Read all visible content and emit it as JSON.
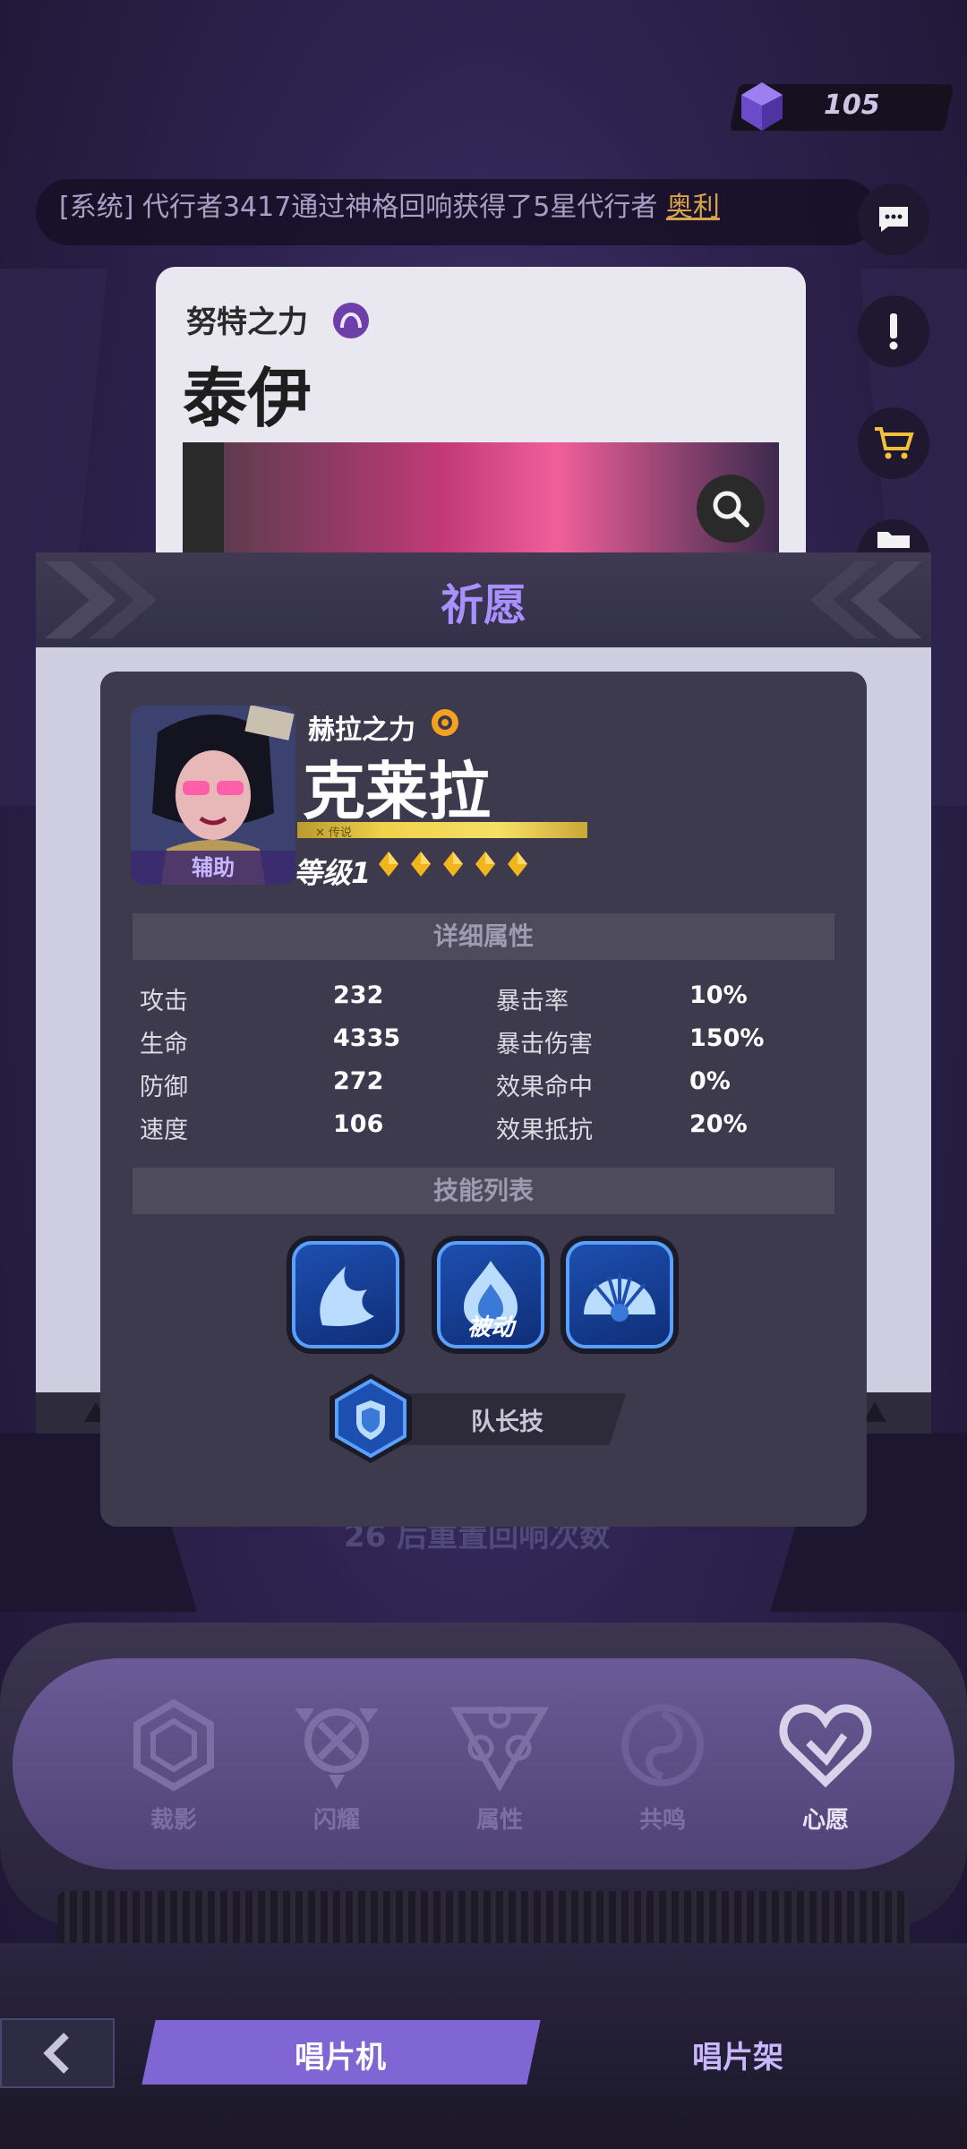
{
  "top_bar": {
    "currency_value": "105"
  },
  "ticker": {
    "prefix": "[系统] 代行者3417通过神格回响获得了5星代行者 ",
    "highlight": "奥利"
  },
  "bg_card": {
    "faction": "努特之力",
    "name": "泰伊"
  },
  "dialog": {
    "title": "祈愿"
  },
  "character": {
    "faction": "赫拉之力",
    "name": "克莱拉",
    "role": "辅助",
    "rarity_label": "传说",
    "level": "等级1",
    "stars": 5
  },
  "attributes": {
    "header": "详细属性",
    "rows": [
      {
        "l1": "攻击",
        "v1": "232",
        "l2": "暴击率",
        "v2": "10%"
      },
      {
        "l1": "生命",
        "v1": "4335",
        "l2": "暴击伤害",
        "v2": "150%"
      },
      {
        "l1": "防御",
        "v1": "272",
        "l2": "效果命中",
        "v2": "0%"
      },
      {
        "l1": "速度",
        "v1": "106",
        "l2": "效果抵抗",
        "v2": "20%"
      }
    ]
  },
  "skills": {
    "header": "技能列表",
    "passive_tag": "被动",
    "leader_label": "队长技"
  },
  "background_hint": "26 后重置回响次数",
  "bottom_nav": {
    "items": [
      {
        "label": "裁影"
      },
      {
        "label": "闪耀"
      },
      {
        "label": "属性"
      },
      {
        "label": "共鸣"
      },
      {
        "label": "心愿"
      }
    ]
  },
  "tabs": {
    "active": "唱片机",
    "inactive": "唱片架"
  }
}
